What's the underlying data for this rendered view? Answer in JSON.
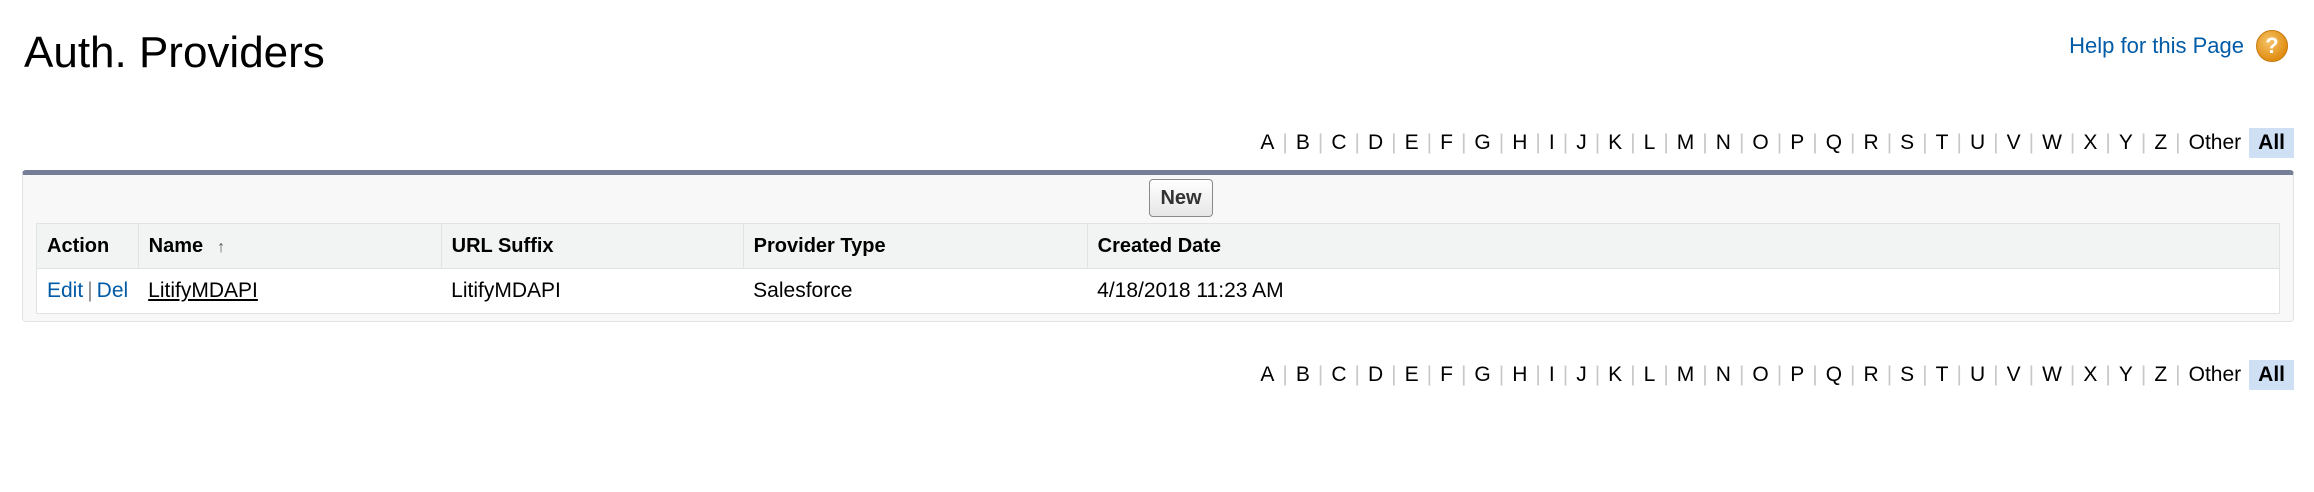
{
  "page": {
    "title": "Auth. Providers",
    "help_label": "Help for this Page",
    "help_icon_glyph": "?"
  },
  "alpha_filter": {
    "letters": [
      "A",
      "B",
      "C",
      "D",
      "E",
      "F",
      "G",
      "H",
      "I",
      "J",
      "K",
      "L",
      "M",
      "N",
      "O",
      "P",
      "Q",
      "R",
      "S",
      "T",
      "U",
      "V",
      "W",
      "X",
      "Y",
      "Z",
      "Other",
      "All"
    ],
    "active": "All"
  },
  "toolbar": {
    "new_label": "New"
  },
  "table": {
    "columns": [
      "Action",
      "Name",
      "URL Suffix",
      "Provider Type",
      "Created Date"
    ],
    "sort_indicator": "↑",
    "rows": [
      {
        "edit": "Edit",
        "sep": "|",
        "del": "Del",
        "name": "LitifyMDAPI",
        "url_suffix": "LitifyMDAPI",
        "provider_type": "Salesforce",
        "created_date": "4/18/2018 11:23 AM"
      }
    ]
  },
  "colors": {
    "link": "#015ba7",
    "panel_border_top": "#747e96",
    "active_filter_bg": "#cfe0f5",
    "help_icon": "#e08e12"
  }
}
